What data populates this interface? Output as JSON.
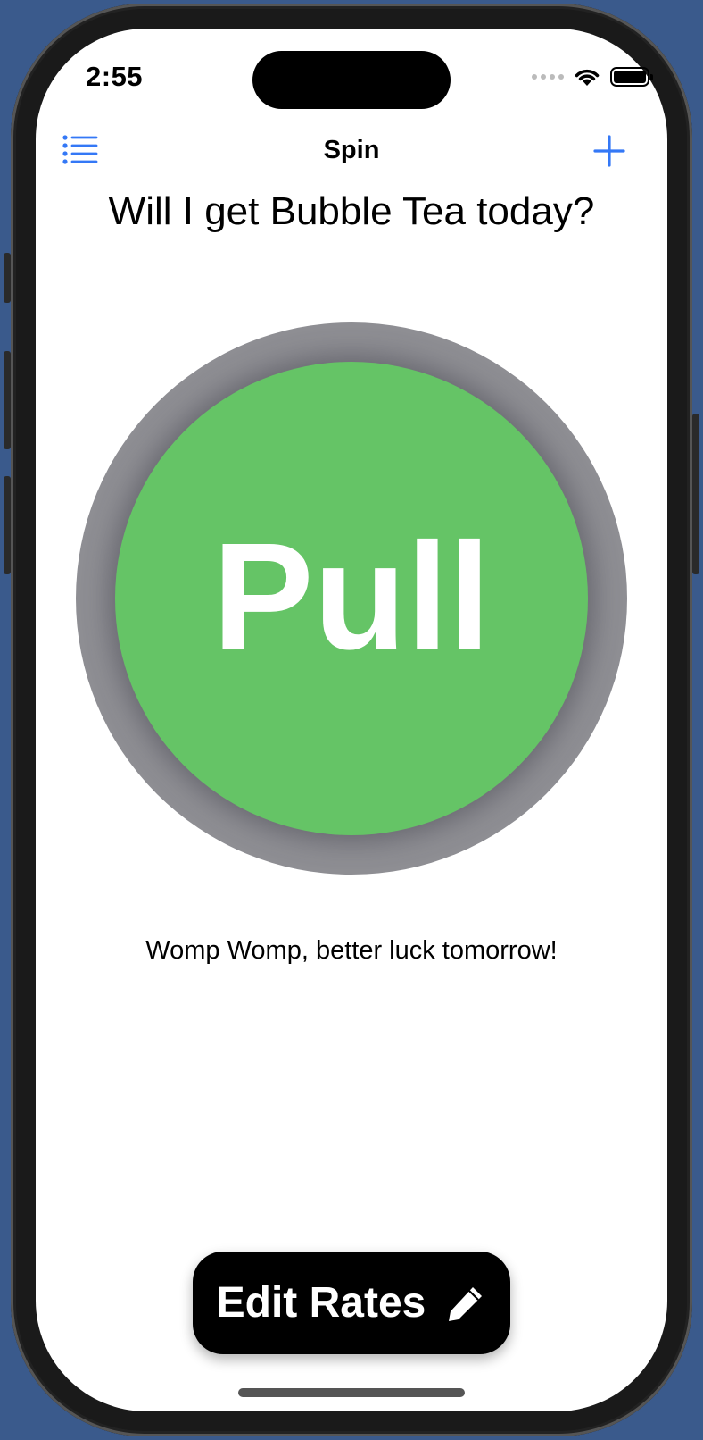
{
  "status_bar": {
    "time": "2:55"
  },
  "nav": {
    "title": "Spin",
    "left_icon": "list-icon",
    "right_icon": "plus-icon"
  },
  "main": {
    "question": "Will I get Bubble Tea today?",
    "pull_label": "Pull",
    "result": "Womp Womp, better luck tomorrow!"
  },
  "footer": {
    "edit_label": "Edit Rates",
    "edit_icon": "pencil-icon"
  },
  "colors": {
    "accent": "#3478f6",
    "pull_green": "#65c466",
    "ring_gray": "#8e8e93",
    "background": "#3a5a8c"
  }
}
